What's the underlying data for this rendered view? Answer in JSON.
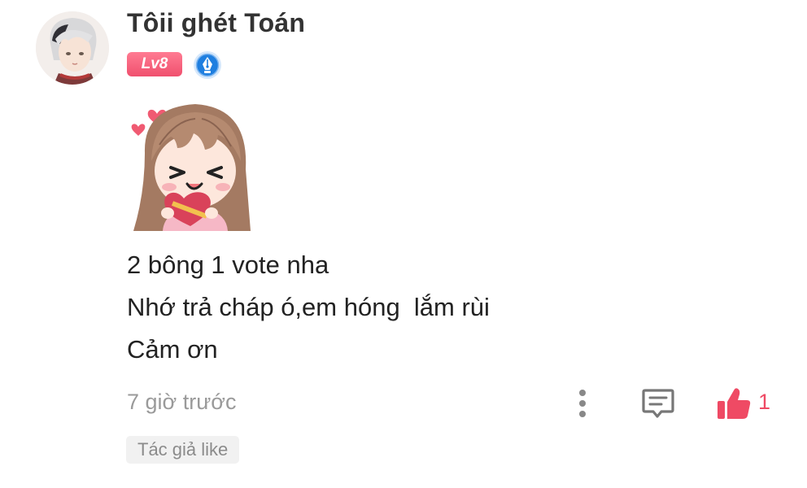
{
  "comment": {
    "author": {
      "name": "Tôii ghét Toán",
      "level_badge": "Lv8",
      "avatar_icon": "avatar-anime-boy",
      "verified_icon": "quill-pen-badge-icon"
    },
    "sticker": "anime-girl-heart-sticker",
    "lines": [
      "2 bông 1 vote nha",
      "Nhớ trả cháp ó,em hóng  lắm rùi",
      "Cảm ơn"
    ],
    "timestamp": "7 giờ trước",
    "actions": {
      "more_icon": "more-vertical-icon",
      "reply_icon": "comment-reply-icon",
      "like_icon": "thumbs-up-icon",
      "like_count": "1"
    },
    "author_like_tag": "Tác giả like"
  },
  "colors": {
    "accent": "#ef4a64",
    "level_badge": "#f0506e",
    "verified": "#1f7fe0",
    "muted_text": "#9a9a9a"
  }
}
